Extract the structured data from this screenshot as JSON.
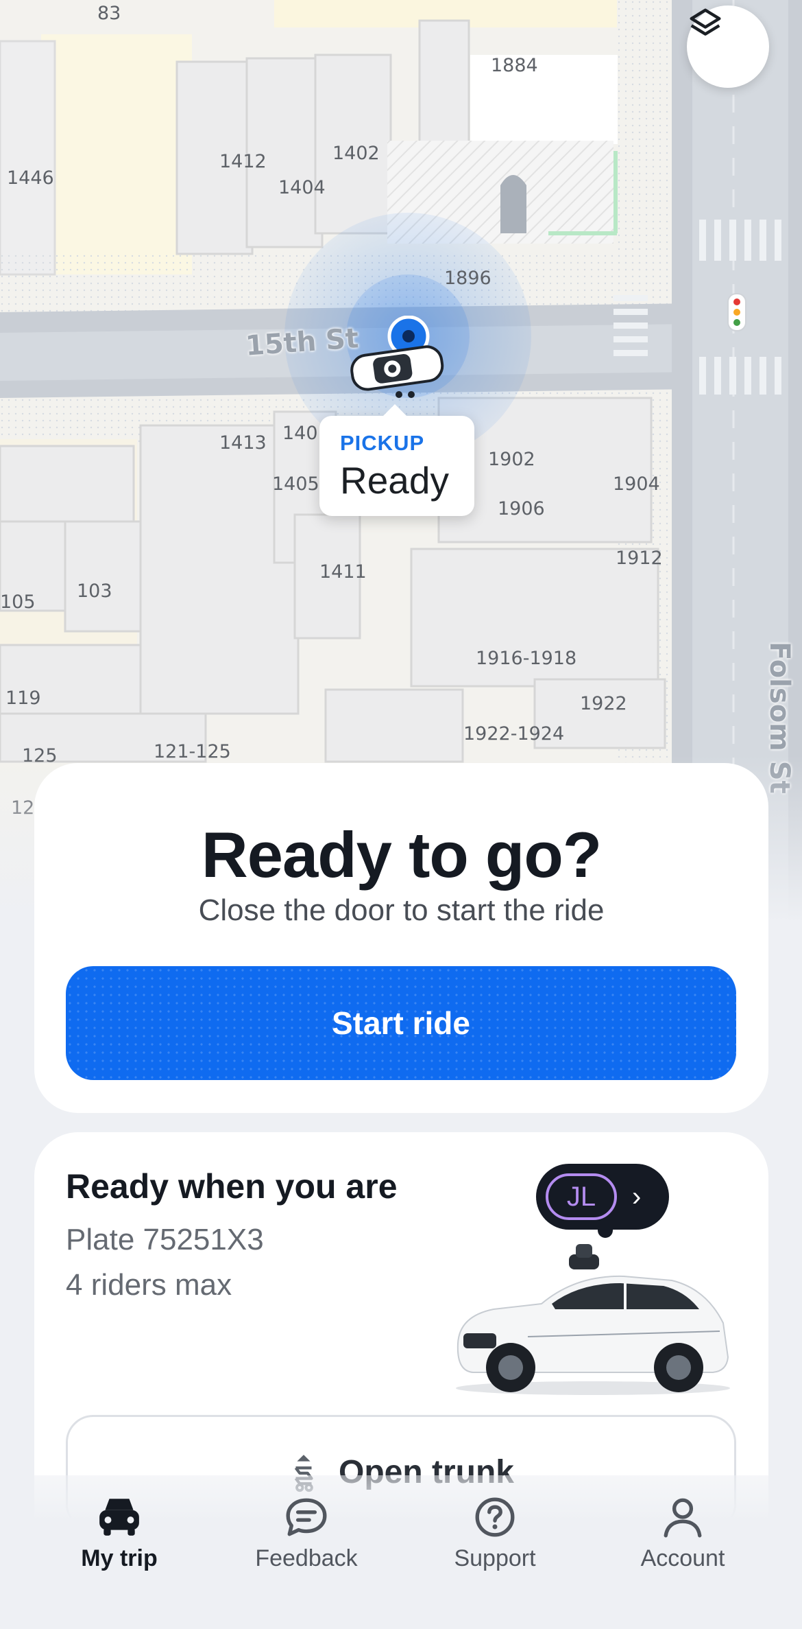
{
  "map": {
    "streets": {
      "horizontal": "15th St",
      "vertical": "Folsom St"
    },
    "building_numbers": [
      "83",
      "1884",
      "1446",
      "1412",
      "1402",
      "1404",
      "1896",
      "1413",
      "140",
      "1405",
      "1902",
      "1904",
      "1906",
      "1912",
      "1411",
      "105",
      "103",
      "1916-1918",
      "119",
      "1922",
      "1922-1924",
      "125",
      "121-125",
      "12"
    ],
    "pickup": {
      "kicker": "PICKUP",
      "status": "Ready"
    },
    "layers_icon": "layers-icon"
  },
  "ready_card": {
    "title": "Ready to go?",
    "subtitle": "Close the door to start the ride",
    "start_button": "Start ride",
    "button_color": "#0f6bf0"
  },
  "vehicle_card": {
    "title": "Ready when you are",
    "plate": "Plate 75251X3",
    "capacity": "4 riders max",
    "rider_initials": "JL",
    "chevron": "›",
    "trunk_button": "Open trunk"
  },
  "nav": {
    "items": [
      {
        "label": "My trip",
        "icon": "car-icon",
        "active": true
      },
      {
        "label": "Feedback",
        "icon": "chat-bubble-icon",
        "active": false
      },
      {
        "label": "Support",
        "icon": "question-circle-icon",
        "active": false
      },
      {
        "label": "Account",
        "icon": "person-icon",
        "active": false
      }
    ]
  }
}
